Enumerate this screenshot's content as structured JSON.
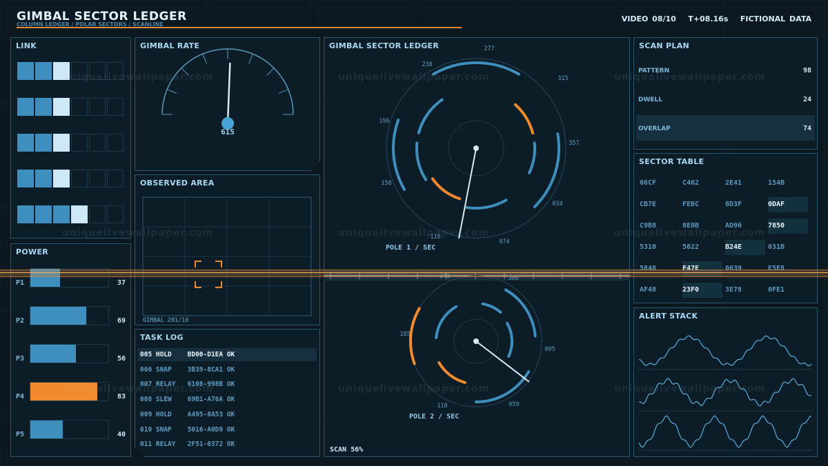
{
  "header": {
    "title": "GIMBAL SECTOR LEDGER",
    "subtitle": "COLUMN LEDGER / POLAR SECTORS / SCANLINE",
    "status": "VIDEO 08/10   T+08.16s   FICTIONAL DATA"
  },
  "link": {
    "title": "LINK",
    "rows": [
      {
        "filled": 2,
        "bright": 1
      },
      {
        "filled": 2,
        "bright": 1
      },
      {
        "filled": 2,
        "bright": 1
      },
      {
        "filled": 2,
        "bright": 1
      },
      {
        "filled": 3,
        "bright": 1
      }
    ]
  },
  "power": {
    "title": "POWER",
    "items": [
      {
        "label": "P1",
        "value": "37",
        "level": 0.37
      },
      {
        "label": "P2",
        "value": "69",
        "level": 0.69
      },
      {
        "label": "P3",
        "value": "56",
        "level": 0.56
      },
      {
        "label": "P4",
        "value": "83",
        "level": 0.83,
        "alert": true
      },
      {
        "label": "P5",
        "value": "40",
        "level": 0.4
      }
    ]
  },
  "gimbal_rate": {
    "title": "GIMBAL RATE",
    "value": "615",
    "level": 0.615
  },
  "observed_area": {
    "title": "OBSERVED AREA",
    "caption": "GIMBAL 201/10"
  },
  "task_log": {
    "title": "TASK LOG",
    "rows": [
      "005 HOLD    BD00-D1EA OK",
      "006 SNAP    3B39-8CA1 OK",
      "007 RELAY   6108-998B OK",
      "008 SLEW    69B1-A76A OK",
      "009 HOLD    A495-8A53 OK",
      "010 SNAP    5016-A0D9 OK",
      "011 RELAY   2F51-0372 OK"
    ],
    "selected": 0
  },
  "sector_ledger": {
    "title": "GIMBAL SECTOR LEDGER",
    "pole1": {
      "label": "POLE 1 / SEC",
      "ticks": [
        "277",
        "315",
        "357",
        "034",
        "074",
        "116",
        "158",
        "196",
        "238"
      ]
    },
    "pole2": {
      "label": "POLE 2 / SEC",
      "ticks": [
        "300",
        "005",
        "059",
        "118",
        "185",
        "241"
      ]
    },
    "scan": "SCAN 56%"
  },
  "scan_plan": {
    "title": "SCAN PLAN",
    "rows": [
      {
        "label": "PATTERN",
        "value": "98"
      },
      {
        "label": "DWELL",
        "value": "24"
      },
      {
        "label": "OVERLAP",
        "value": "74",
        "highlight": true
      }
    ]
  },
  "sector_table": {
    "title": "SECTOR TABLE",
    "cells": [
      [
        "06CF",
        "C462",
        "2E41",
        "154B"
      ],
      [
        "CB7E",
        "FEBC",
        "8D3F",
        "0DAF"
      ],
      [
        "C9B8",
        "8E0B",
        "AD96",
        "7850"
      ],
      [
        "5310",
        "5622",
        "B24E",
        "031B"
      ],
      [
        "5848",
        "F47E",
        "0639",
        "E5E8"
      ],
      [
        "AF48",
        "23F0",
        "3E78",
        "0FE1"
      ]
    ],
    "highlights": [
      [
        1,
        3
      ],
      [
        2,
        3
      ],
      [
        3,
        2
      ],
      [
        4,
        1
      ],
      [
        5,
        1
      ]
    ]
  },
  "alert_stack": {
    "title": "ALERT STACK"
  },
  "watermark": "uniquelivewallpaper.com",
  "colors": {
    "accent": "#3e8fbd",
    "alert": "#f08a2d",
    "bright": "#cfe8f7",
    "border": "#2a5670"
  }
}
